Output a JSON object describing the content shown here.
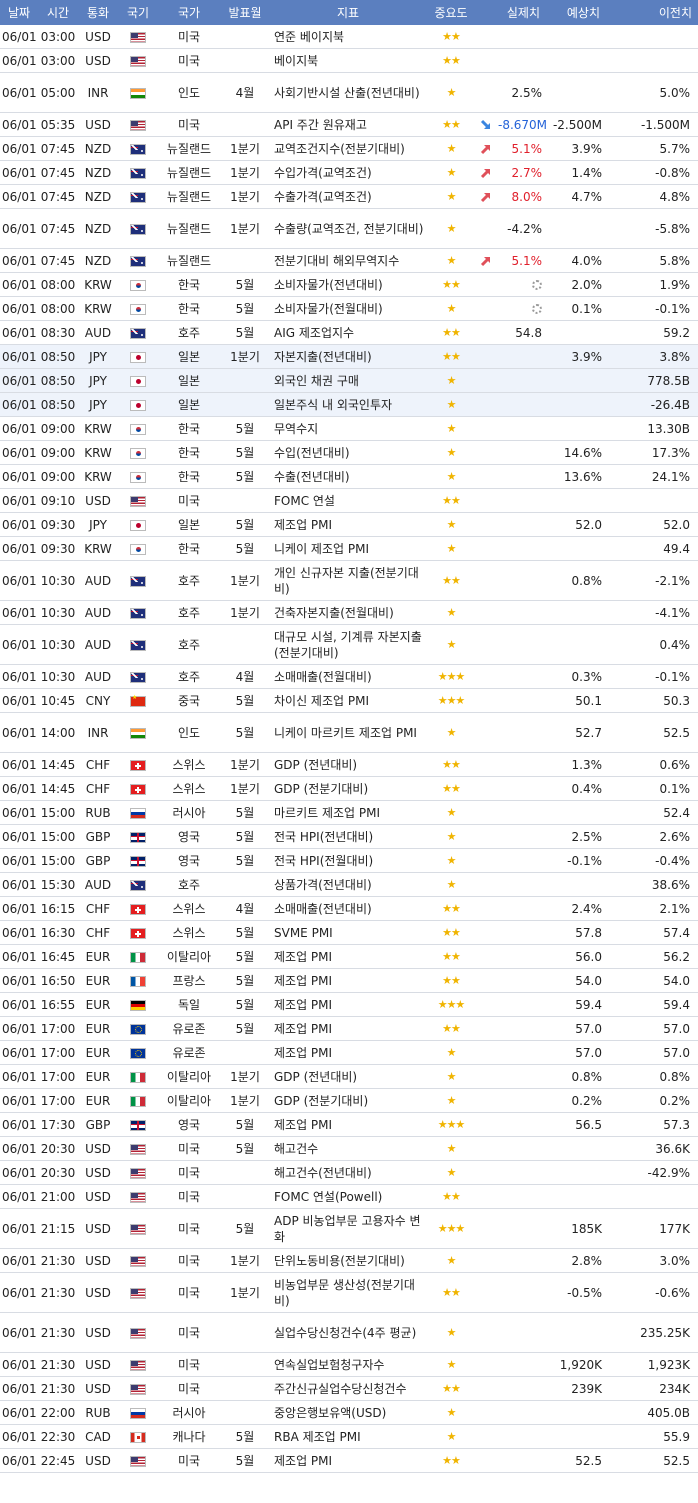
{
  "header": {
    "date": "날짜",
    "time": "시간",
    "currency": "통화",
    "flag": "국기",
    "country": "국가",
    "period": "발표월",
    "indicator": "지표",
    "importance": "중요도",
    "actual": "실제치",
    "forecast": "예상치",
    "previous": "이전치"
  },
  "rows": [
    {
      "date": "06/01",
      "time": "03:00",
      "cur": "USD",
      "flag": "us",
      "country": "미국",
      "period": "",
      "indicator": "연준 베이지북",
      "stars": "★★",
      "arrow": "",
      "actual": "",
      "forecast": "",
      "previous": "",
      "tall": false,
      "hl": false,
      "spinner": false
    },
    {
      "date": "06/01",
      "time": "03:00",
      "cur": "USD",
      "flag": "us",
      "country": "미국",
      "period": "",
      "indicator": "베이지북",
      "stars": "★★",
      "arrow": "",
      "actual": "",
      "forecast": "",
      "previous": "",
      "tall": false,
      "hl": false,
      "spinner": false
    },
    {
      "date": "06/01",
      "time": "05:00",
      "cur": "INR",
      "flag": "in",
      "country": "인도",
      "period": "4월",
      "indicator": "사회기반시설 산출(전년대비)",
      "stars": "★",
      "arrow": "",
      "actual": "2.5%",
      "forecast": "",
      "previous": "5.0%",
      "tall": true,
      "hl": false,
      "spinner": false
    },
    {
      "date": "06/01",
      "time": "05:35",
      "cur": "USD",
      "flag": "us",
      "country": "미국",
      "period": "",
      "indicator": "API 주간 원유재고",
      "stars": "★★",
      "arrow": "down",
      "actual": "-8.670M",
      "forecast": "-2.500M",
      "previous": "-1.500M",
      "tall": false,
      "hl": false,
      "spinner": false
    },
    {
      "date": "06/01",
      "time": "07:45",
      "cur": "NZD",
      "flag": "nz",
      "country": "뉴질랜드",
      "period": "1분기",
      "indicator": "교역조건지수(전분기대비)",
      "stars": "★",
      "arrow": "up",
      "actual": "5.1%",
      "forecast": "3.9%",
      "previous": "5.7%",
      "tall": false,
      "hl": false,
      "spinner": false
    },
    {
      "date": "06/01",
      "time": "07:45",
      "cur": "NZD",
      "flag": "nz",
      "country": "뉴질랜드",
      "period": "1분기",
      "indicator": "수입가격(교역조건)",
      "stars": "★",
      "arrow": "up",
      "actual": "2.7%",
      "forecast": "1.4%",
      "previous": "-0.8%",
      "tall": false,
      "hl": false,
      "spinner": false
    },
    {
      "date": "06/01",
      "time": "07:45",
      "cur": "NZD",
      "flag": "nz",
      "country": "뉴질랜드",
      "period": "1분기",
      "indicator": "수출가격(교역조건)",
      "stars": "★",
      "arrow": "up",
      "actual": "8.0%",
      "forecast": "4.7%",
      "previous": "4.8%",
      "tall": false,
      "hl": false,
      "spinner": false
    },
    {
      "date": "06/01",
      "time": "07:45",
      "cur": "NZD",
      "flag": "nz",
      "country": "뉴질랜드",
      "period": "1분기",
      "indicator": "수출량(교역조건, 전분기대비)",
      "stars": "★",
      "arrow": "",
      "actual": "-4.2%",
      "forecast": "",
      "previous": "-5.8%",
      "tall": true,
      "hl": false,
      "spinner": false
    },
    {
      "date": "06/01",
      "time": "07:45",
      "cur": "NZD",
      "flag": "nz",
      "country": "뉴질랜드",
      "period": "",
      "indicator": "전분기대비 해외무역지수",
      "stars": "★",
      "arrow": "up",
      "actual": "5.1%",
      "forecast": "4.0%",
      "previous": "5.8%",
      "tall": false,
      "hl": false,
      "spinner": false
    },
    {
      "date": "06/01",
      "time": "08:00",
      "cur": "KRW",
      "flag": "kr",
      "country": "한국",
      "period": "5월",
      "indicator": "소비자물가(전년대비)",
      "stars": "★★",
      "arrow": "",
      "actual": "",
      "forecast": "2.0%",
      "previous": "1.9%",
      "tall": false,
      "hl": false,
      "spinner": true
    },
    {
      "date": "06/01",
      "time": "08:00",
      "cur": "KRW",
      "flag": "kr",
      "country": "한국",
      "period": "5월",
      "indicator": "소비자물가(전월대비)",
      "stars": "★",
      "arrow": "",
      "actual": "",
      "forecast": "0.1%",
      "previous": "-0.1%",
      "tall": false,
      "hl": false,
      "spinner": true
    },
    {
      "date": "06/01",
      "time": "08:30",
      "cur": "AUD",
      "flag": "au",
      "country": "호주",
      "period": "5월",
      "indicator": "AIG 제조업지수",
      "stars": "★★",
      "arrow": "",
      "actual": "54.8",
      "forecast": "",
      "previous": "59.2",
      "tall": false,
      "hl": false,
      "spinner": false
    },
    {
      "date": "06/01",
      "time": "08:50",
      "cur": "JPY",
      "flag": "jp",
      "country": "일본",
      "period": "1분기",
      "indicator": "자본지출(전년대비)",
      "stars": "★★",
      "arrow": "",
      "actual": "",
      "forecast": "3.9%",
      "previous": "3.8%",
      "tall": false,
      "hl": true,
      "spinner": false
    },
    {
      "date": "06/01",
      "time": "08:50",
      "cur": "JPY",
      "flag": "jp",
      "country": "일본",
      "period": "",
      "indicator": "외국인 채권 구매",
      "stars": "★",
      "arrow": "",
      "actual": "",
      "forecast": "",
      "previous": "778.5B",
      "tall": false,
      "hl": true,
      "spinner": false
    },
    {
      "date": "06/01",
      "time": "08:50",
      "cur": "JPY",
      "flag": "jp",
      "country": "일본",
      "period": "",
      "indicator": "일본주식 내 외국인투자",
      "stars": "★",
      "arrow": "",
      "actual": "",
      "forecast": "",
      "previous": "-26.4B",
      "tall": false,
      "hl": true,
      "spinner": false
    },
    {
      "date": "06/01",
      "time": "09:00",
      "cur": "KRW",
      "flag": "kr",
      "country": "한국",
      "period": "5월",
      "indicator": "무역수지",
      "stars": "★",
      "arrow": "",
      "actual": "",
      "forecast": "",
      "previous": "13.30B",
      "tall": false,
      "hl": false,
      "spinner": false
    },
    {
      "date": "06/01",
      "time": "09:00",
      "cur": "KRW",
      "flag": "kr",
      "country": "한국",
      "period": "5월",
      "indicator": "수입(전년대비)",
      "stars": "★",
      "arrow": "",
      "actual": "",
      "forecast": "14.6%",
      "previous": "17.3%",
      "tall": false,
      "hl": false,
      "spinner": false
    },
    {
      "date": "06/01",
      "time": "09:00",
      "cur": "KRW",
      "flag": "kr",
      "country": "한국",
      "period": "5월",
      "indicator": "수출(전년대비)",
      "stars": "★",
      "arrow": "",
      "actual": "",
      "forecast": "13.6%",
      "previous": "24.1%",
      "tall": false,
      "hl": false,
      "spinner": false
    },
    {
      "date": "06/01",
      "time": "09:10",
      "cur": "USD",
      "flag": "us",
      "country": "미국",
      "period": "",
      "indicator": "FOMC 연설",
      "stars": "★★",
      "arrow": "",
      "actual": "",
      "forecast": "",
      "previous": "",
      "tall": false,
      "hl": false,
      "spinner": false
    },
    {
      "date": "06/01",
      "time": "09:30",
      "cur": "JPY",
      "flag": "jp",
      "country": "일본",
      "period": "5월",
      "indicator": "제조업 PMI",
      "stars": "★",
      "arrow": "",
      "actual": "",
      "forecast": "52.0",
      "previous": "52.0",
      "tall": false,
      "hl": false,
      "spinner": false
    },
    {
      "date": "06/01",
      "time": "09:30",
      "cur": "KRW",
      "flag": "kr",
      "country": "한국",
      "period": "5월",
      "indicator": "니케이 제조업 PMI",
      "stars": "★",
      "arrow": "",
      "actual": "",
      "forecast": "",
      "previous": "49.4",
      "tall": false,
      "hl": false,
      "spinner": false
    },
    {
      "date": "06/01",
      "time": "10:30",
      "cur": "AUD",
      "flag": "au",
      "country": "호주",
      "period": "1분기",
      "indicator": "개인 신규자본 지출(전분기대비)",
      "stars": "★★",
      "arrow": "",
      "actual": "",
      "forecast": "0.8%",
      "previous": "-2.1%",
      "tall": true,
      "hl": false,
      "spinner": false
    },
    {
      "date": "06/01",
      "time": "10:30",
      "cur": "AUD",
      "flag": "au",
      "country": "호주",
      "period": "1분기",
      "indicator": "건축자본지출(전월대비)",
      "stars": "★",
      "arrow": "",
      "actual": "",
      "forecast": "",
      "previous": "-4.1%",
      "tall": false,
      "hl": false,
      "spinner": false
    },
    {
      "date": "06/01",
      "time": "10:30",
      "cur": "AUD",
      "flag": "au",
      "country": "호주",
      "period": "",
      "indicator": "대규모 시설, 기계류 자본지출(전분기대비)",
      "stars": "★",
      "arrow": "",
      "actual": "",
      "forecast": "",
      "previous": "0.4%",
      "tall": true,
      "hl": false,
      "spinner": false
    },
    {
      "date": "06/01",
      "time": "10:30",
      "cur": "AUD",
      "flag": "au",
      "country": "호주",
      "period": "4월",
      "indicator": "소매매출(전월대비)",
      "stars": "★★★",
      "arrow": "",
      "actual": "",
      "forecast": "0.3%",
      "previous": "-0.1%",
      "tall": false,
      "hl": false,
      "spinner": false
    },
    {
      "date": "06/01",
      "time": "10:45",
      "cur": "CNY",
      "flag": "cn",
      "country": "중국",
      "period": "5월",
      "indicator": "차이신 제조업 PMI",
      "stars": "★★★",
      "arrow": "",
      "actual": "",
      "forecast": "50.1",
      "previous": "50.3",
      "tall": false,
      "hl": false,
      "spinner": false
    },
    {
      "date": "06/01",
      "time": "14:00",
      "cur": "INR",
      "flag": "in",
      "country": "인도",
      "period": "5월",
      "indicator": "니케이 마르키트 제조업 PMI",
      "stars": "★",
      "arrow": "",
      "actual": "",
      "forecast": "52.7",
      "previous": "52.5",
      "tall": true,
      "hl": false,
      "spinner": false
    },
    {
      "date": "06/01",
      "time": "14:45",
      "cur": "CHF",
      "flag": "ch",
      "country": "스위스",
      "period": "1분기",
      "indicator": "GDP (전년대비)",
      "stars": "★★",
      "arrow": "",
      "actual": "",
      "forecast": "1.3%",
      "previous": "0.6%",
      "tall": false,
      "hl": false,
      "spinner": false
    },
    {
      "date": "06/01",
      "time": "14:45",
      "cur": "CHF",
      "flag": "ch",
      "country": "스위스",
      "period": "1분기",
      "indicator": "GDP (전분기대비)",
      "stars": "★★",
      "arrow": "",
      "actual": "",
      "forecast": "0.4%",
      "previous": "0.1%",
      "tall": false,
      "hl": false,
      "spinner": false
    },
    {
      "date": "06/01",
      "time": "15:00",
      "cur": "RUB",
      "flag": "ru",
      "country": "러시아",
      "period": "5월",
      "indicator": "마르키트 제조업 PMI",
      "stars": "★",
      "arrow": "",
      "actual": "",
      "forecast": "",
      "previous": "52.4",
      "tall": false,
      "hl": false,
      "spinner": false
    },
    {
      "date": "06/01",
      "time": "15:00",
      "cur": "GBP",
      "flag": "gb",
      "country": "영국",
      "period": "5월",
      "indicator": "전국 HPI(전년대비)",
      "stars": "★",
      "arrow": "",
      "actual": "",
      "forecast": "2.5%",
      "previous": "2.6%",
      "tall": false,
      "hl": false,
      "spinner": false
    },
    {
      "date": "06/01",
      "time": "15:00",
      "cur": "GBP",
      "flag": "gb",
      "country": "영국",
      "period": "5월",
      "indicator": "전국 HPI(전월대비)",
      "stars": "★",
      "arrow": "",
      "actual": "",
      "forecast": "-0.1%",
      "previous": "-0.4%",
      "tall": false,
      "hl": false,
      "spinner": false
    },
    {
      "date": "06/01",
      "time": "15:30",
      "cur": "AUD",
      "flag": "au",
      "country": "호주",
      "period": "",
      "indicator": "상품가격(전년대비)",
      "stars": "★",
      "arrow": "",
      "actual": "",
      "forecast": "",
      "previous": "38.6%",
      "tall": false,
      "hl": false,
      "spinner": false
    },
    {
      "date": "06/01",
      "time": "16:15",
      "cur": "CHF",
      "flag": "ch",
      "country": "스위스",
      "period": "4월",
      "indicator": "소매매출(전년대비)",
      "stars": "★★",
      "arrow": "",
      "actual": "",
      "forecast": "2.4%",
      "previous": "2.1%",
      "tall": false,
      "hl": false,
      "spinner": false
    },
    {
      "date": "06/01",
      "time": "16:30",
      "cur": "CHF",
      "flag": "ch",
      "country": "스위스",
      "period": "5월",
      "indicator": "SVME PMI",
      "stars": "★★",
      "arrow": "",
      "actual": "",
      "forecast": "57.8",
      "previous": "57.4",
      "tall": false,
      "hl": false,
      "spinner": false
    },
    {
      "date": "06/01",
      "time": "16:45",
      "cur": "EUR",
      "flag": "it",
      "country": "이탈리아",
      "period": "5월",
      "indicator": "제조업 PMI",
      "stars": "★★",
      "arrow": "",
      "actual": "",
      "forecast": "56.0",
      "previous": "56.2",
      "tall": false,
      "hl": false,
      "spinner": false
    },
    {
      "date": "06/01",
      "time": "16:50",
      "cur": "EUR",
      "flag": "fr",
      "country": "프랑스",
      "period": "5월",
      "indicator": "제조업 PMI",
      "stars": "★★",
      "arrow": "",
      "actual": "",
      "forecast": "54.0",
      "previous": "54.0",
      "tall": false,
      "hl": false,
      "spinner": false
    },
    {
      "date": "06/01",
      "time": "16:55",
      "cur": "EUR",
      "flag": "de",
      "country": "독일",
      "period": "5월",
      "indicator": "제조업 PMI",
      "stars": "★★★",
      "arrow": "",
      "actual": "",
      "forecast": "59.4",
      "previous": "59.4",
      "tall": false,
      "hl": false,
      "spinner": false
    },
    {
      "date": "06/01",
      "time": "17:00",
      "cur": "EUR",
      "flag": "eu",
      "country": "유로존",
      "period": "5월",
      "indicator": "제조업 PMI",
      "stars": "★★",
      "arrow": "",
      "actual": "",
      "forecast": "57.0",
      "previous": "57.0",
      "tall": false,
      "hl": false,
      "spinner": false
    },
    {
      "date": "06/01",
      "time": "17:00",
      "cur": "EUR",
      "flag": "eu",
      "country": "유로존",
      "period": "",
      "indicator": "제조업 PMI",
      "stars": "★",
      "arrow": "",
      "actual": "",
      "forecast": "57.0",
      "previous": "57.0",
      "tall": false,
      "hl": false,
      "spinner": false
    },
    {
      "date": "06/01",
      "time": "17:00",
      "cur": "EUR",
      "flag": "it",
      "country": "이탈리아",
      "period": "1분기",
      "indicator": "GDP (전년대비)",
      "stars": "★",
      "arrow": "",
      "actual": "",
      "forecast": "0.8%",
      "previous": "0.8%",
      "tall": false,
      "hl": false,
      "spinner": false
    },
    {
      "date": "06/01",
      "time": "17:00",
      "cur": "EUR",
      "flag": "it",
      "country": "이탈리아",
      "period": "1분기",
      "indicator": "GDP (전분기대비)",
      "stars": "★",
      "arrow": "",
      "actual": "",
      "forecast": "0.2%",
      "previous": "0.2%",
      "tall": false,
      "hl": false,
      "spinner": false
    },
    {
      "date": "06/01",
      "time": "17:30",
      "cur": "GBP",
      "flag": "gb",
      "country": "영국",
      "period": "5월",
      "indicator": "제조업 PMI",
      "stars": "★★★",
      "arrow": "",
      "actual": "",
      "forecast": "56.5",
      "previous": "57.3",
      "tall": false,
      "hl": false,
      "spinner": false
    },
    {
      "date": "06/01",
      "time": "20:30",
      "cur": "USD",
      "flag": "us",
      "country": "미국",
      "period": "5월",
      "indicator": "해고건수",
      "stars": "★",
      "arrow": "",
      "actual": "",
      "forecast": "",
      "previous": "36.6K",
      "tall": false,
      "hl": false,
      "spinner": false
    },
    {
      "date": "06/01",
      "time": "20:30",
      "cur": "USD",
      "flag": "us",
      "country": "미국",
      "period": "",
      "indicator": "해고건수(전년대비)",
      "stars": "★",
      "arrow": "",
      "actual": "",
      "forecast": "",
      "previous": "-42.9%",
      "tall": false,
      "hl": false,
      "spinner": false
    },
    {
      "date": "06/01",
      "time": "21:00",
      "cur": "USD",
      "flag": "us",
      "country": "미국",
      "period": "",
      "indicator": "FOMC 연설(Powell)",
      "stars": "★★",
      "arrow": "",
      "actual": "",
      "forecast": "",
      "previous": "",
      "tall": false,
      "hl": false,
      "spinner": false
    },
    {
      "date": "06/01",
      "time": "21:15",
      "cur": "USD",
      "flag": "us",
      "country": "미국",
      "period": "5월",
      "indicator": "ADP 비농업부문 고용자수 변화",
      "stars": "★★★",
      "arrow": "",
      "actual": "",
      "forecast": "185K",
      "previous": "177K",
      "tall": true,
      "hl": false,
      "spinner": false
    },
    {
      "date": "06/01",
      "time": "21:30",
      "cur": "USD",
      "flag": "us",
      "country": "미국",
      "period": "1분기",
      "indicator": "단위노동비용(전분기대비)",
      "stars": "★",
      "arrow": "",
      "actual": "",
      "forecast": "2.8%",
      "previous": "3.0%",
      "tall": false,
      "hl": false,
      "spinner": false
    },
    {
      "date": "06/01",
      "time": "21:30",
      "cur": "USD",
      "flag": "us",
      "country": "미국",
      "period": "1분기",
      "indicator": "비농업부문 생산성(전분기대비)",
      "stars": "★★",
      "arrow": "",
      "actual": "",
      "forecast": "-0.5%",
      "previous": "-0.6%",
      "tall": true,
      "hl": false,
      "spinner": false
    },
    {
      "date": "06/01",
      "time": "21:30",
      "cur": "USD",
      "flag": "us",
      "country": "미국",
      "period": "",
      "indicator": "실업수당신청건수(4주 평균)",
      "stars": "★",
      "arrow": "",
      "actual": "",
      "forecast": "",
      "previous": "235.25K",
      "tall": true,
      "hl": false,
      "spinner": false
    },
    {
      "date": "06/01",
      "time": "21:30",
      "cur": "USD",
      "flag": "us",
      "country": "미국",
      "period": "",
      "indicator": "연속실업보험청구자수",
      "stars": "★",
      "arrow": "",
      "actual": "",
      "forecast": "1,920K",
      "previous": "1,923K",
      "tall": false,
      "hl": false,
      "spinner": false
    },
    {
      "date": "06/01",
      "time": "21:30",
      "cur": "USD",
      "flag": "us",
      "country": "미국",
      "period": "",
      "indicator": "주간신규실업수당신청건수",
      "stars": "★★",
      "arrow": "",
      "actual": "",
      "forecast": "239K",
      "previous": "234K",
      "tall": false,
      "hl": false,
      "spinner": false
    },
    {
      "date": "06/01",
      "time": "22:00",
      "cur": "RUB",
      "flag": "ru",
      "country": "러시아",
      "period": "",
      "indicator": "중앙은행보유액(USD)",
      "stars": "★",
      "arrow": "",
      "actual": "",
      "forecast": "",
      "previous": "405.0B",
      "tall": false,
      "hl": false,
      "spinner": false
    },
    {
      "date": "06/01",
      "time": "22:30",
      "cur": "CAD",
      "flag": "ca",
      "country": "캐나다",
      "period": "5월",
      "indicator": "RBA 제조업 PMI",
      "stars": "★",
      "arrow": "",
      "actual": "",
      "forecast": "",
      "previous": "55.9",
      "tall": false,
      "hl": false,
      "spinner": false
    },
    {
      "date": "06/01",
      "time": "22:45",
      "cur": "USD",
      "flag": "us",
      "country": "미국",
      "period": "5월",
      "indicator": "제조업 PMI",
      "stars": "★★",
      "arrow": "",
      "actual": "",
      "forecast": "52.5",
      "previous": "52.5",
      "tall": false,
      "hl": false,
      "spinner": false
    }
  ],
  "colors": {
    "header_bg": "#5b7fbf",
    "star": "#f0b400",
    "up": "#e0202c",
    "down": "#2563d8",
    "row_border": "#d8dce3"
  }
}
